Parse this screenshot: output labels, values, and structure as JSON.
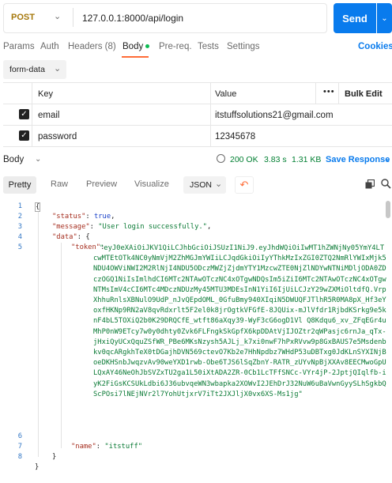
{
  "request": {
    "method": "POST",
    "url": "127.0.0.1:8000/api/login",
    "send_label": "Send"
  },
  "tabs": [
    {
      "label": "Params"
    },
    {
      "label": "Auth"
    },
    {
      "label": "Headers (8)"
    },
    {
      "label": "Body"
    },
    {
      "label": "Pre-req."
    },
    {
      "label": "Tests"
    },
    {
      "label": "Settings"
    }
  ],
  "cookies_label": "Cookies",
  "body_mode": "form-data",
  "params_table": {
    "headers": {
      "key": "Key",
      "value": "Value",
      "more": "•••",
      "bulk_edit": "Bulk Edit"
    },
    "rows": [
      {
        "checked": true,
        "key": "email",
        "value": "itstuffsolutions21@gmail.com"
      },
      {
        "checked": true,
        "key": "password",
        "value": "12345678"
      }
    ]
  },
  "response": {
    "title": "Body",
    "status": "200 OK",
    "time": "3.83 s",
    "size": "1.31 KB",
    "save_label": "Save Response",
    "view_tabs": {
      "pretty": "Pretty",
      "raw": "Raw",
      "preview": "Preview",
      "visualize": "Visualize"
    },
    "format": "JSON"
  },
  "code": {
    "line_numbers": [
      "1",
      "2",
      "3",
      "4",
      "5",
      "6",
      "7",
      "8"
    ],
    "open_brace": "{",
    "close_brace": "}",
    "inner_open": "{",
    "inner_close": "}",
    "status_key": "\"status\"",
    "status_value": "true",
    "message_key": "\"message\"",
    "message_value": "\"User login successfully.\"",
    "data_key": "\"data\"",
    "token_key": "\"token\"",
    "token_value": "\"eyJ0eXAiOiJKV1QiLCJhbGciOiJSUzI1NiJ9.eyJhdWQiOiIwMT1hZWNjNy05YmY4LTcwMTEtOTk4NC0yNmVjM2ZhMGJmYWIiLCJqdGkiOiIyYThkMzIxZGI0ZTQ2NmRlYWIxMjk5NDU4OWViNWI2M2RlNjI4NDU5ODczMWZjZjdmYTY1MzcwZTE0NjZlNDYwNTNiMDljODA0ZDczOGQ1NiIsImlhdCI6MTc2NTAwOTczNC4xOTgwNDQsIm5iZiI6MTc2NTAwOTczNC4xOTgwNTMsImV4cCI6MTc4MDczNDUzMy45MTU3MDEsInN1YiI6IjUiLCJzY29wZXMiOltdfQ.VrpXhhuRnlsXBNulO9UdP_nJvQEpdOML_0GfuBmy940XIqiN5DWUQFJTlhR5R0MA8pX_Hf3eYoxfHKNp9RN2aV8qvRdxrlt5F2el0k8jrOgtkVFGfE-8JQUix-mJlVfdr1RjbdKSrkg9e5knF4bL5TOXiQ2b0K29DRQCfE_wtft86aXqy39-WyF3cG6ogD1Vl Q8Kdqu6_xv_ZFqEGr4uMhP0nW9ETcy7w0y0dhty0Zvk6FLFngkSkGpfX6kpDDAtVjIJOZtr2qWPasjc6rnJa_qTx-jHxiQyUCxQquZSfWR_PBe6MKsNzysh5AJLj_k7xi0nwF7hPxRVvw9p8GxBAUS7e5Msdenbkv0qcARgkhTeX0tDGajhDVN569ctevO7Kb2e7HhNpdbz7WHdP53uDBTxg0JdKLnSYXINjBoeDKHSnbJwqzvAv90weYXD1rwb-Obe6TJS6lSqZbnY-RATR_zUYvNpBjXXAv8EECMwoGpULQxAY46NeOhJbSVZxTU2ga1L50iXtADA2ZR-0Cb1LcTFfSNCc-VYr4jP-2JptjQIqlfb-iyK2FiGsKCSUkLdbi6J36ubvqeWN3wbapka2XOWvI2JEhDrJ32NuW6uBaVwnGyySLhSgkbQScPOsi7lNEjNVr2l7YohUtjxrV7iTt2JXJljX0vx6XS-Ms1jg\"",
    "name_key": "\"name\"",
    "name_value": "\"itstuff\""
  },
  "colors": {
    "accent": "#097bed",
    "method": "#a5770a",
    "status_ok": "#007f31",
    "tab_indicator": "#ff6c37"
  }
}
